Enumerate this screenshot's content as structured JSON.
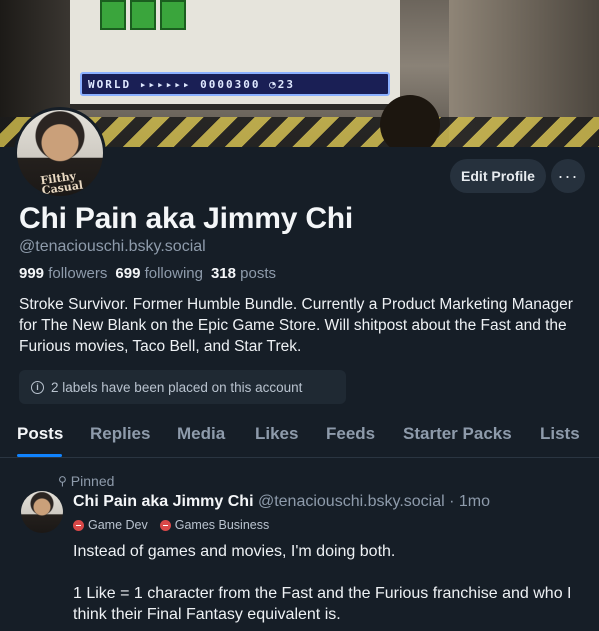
{
  "banner": {
    "hud_text": "WORLD ▸▸▸▸▸▸ 0000300 ◔23"
  },
  "avatar": {
    "shirt_text": "Filthy Casual"
  },
  "actions": {
    "edit_label": "Edit Profile",
    "more_label": "···"
  },
  "profile": {
    "display_name": "Chi Pain aka Jimmy Chi",
    "handle": "@tenaciouschi.bsky.social",
    "followers_count": "999",
    "followers_label": "followers",
    "following_count": "699",
    "following_label": "following",
    "posts_count": "318",
    "posts_label": "posts",
    "bio": "Stroke Survivor. Former Humble Bundle. Currently a Product Marketing Manager for The New Blank on the Epic Game Store. Will shitpost about the Fast and the Furious movies, Taco Bell, and Star Trek.",
    "labels_notice": "2 labels have been placed on this account"
  },
  "tabs": [
    {
      "label": "Posts"
    },
    {
      "label": "Replies"
    },
    {
      "label": "Media"
    },
    {
      "label": "Likes"
    },
    {
      "label": "Feeds"
    },
    {
      "label": "Starter Packs"
    },
    {
      "label": "Lists"
    }
  ],
  "post": {
    "pinned_label": "Pinned",
    "author_name": "Chi Pain aka Jimmy Chi",
    "author_handle": "@tenaciouschi.bsky.social",
    "time": "· 1mo",
    "labels": [
      "Game Dev",
      "Games Business"
    ],
    "paragraphs": [
      "Instead of games and movies, I'm doing both.",
      "1 Like = 1 character from the Fast and the Furious franchise and who I think their Final Fantasy equivalent is."
    ]
  },
  "colors": {
    "background": "#161e27",
    "accent": "#1083fe",
    "muted": "#8e9bab",
    "label_red": "#d94848"
  }
}
